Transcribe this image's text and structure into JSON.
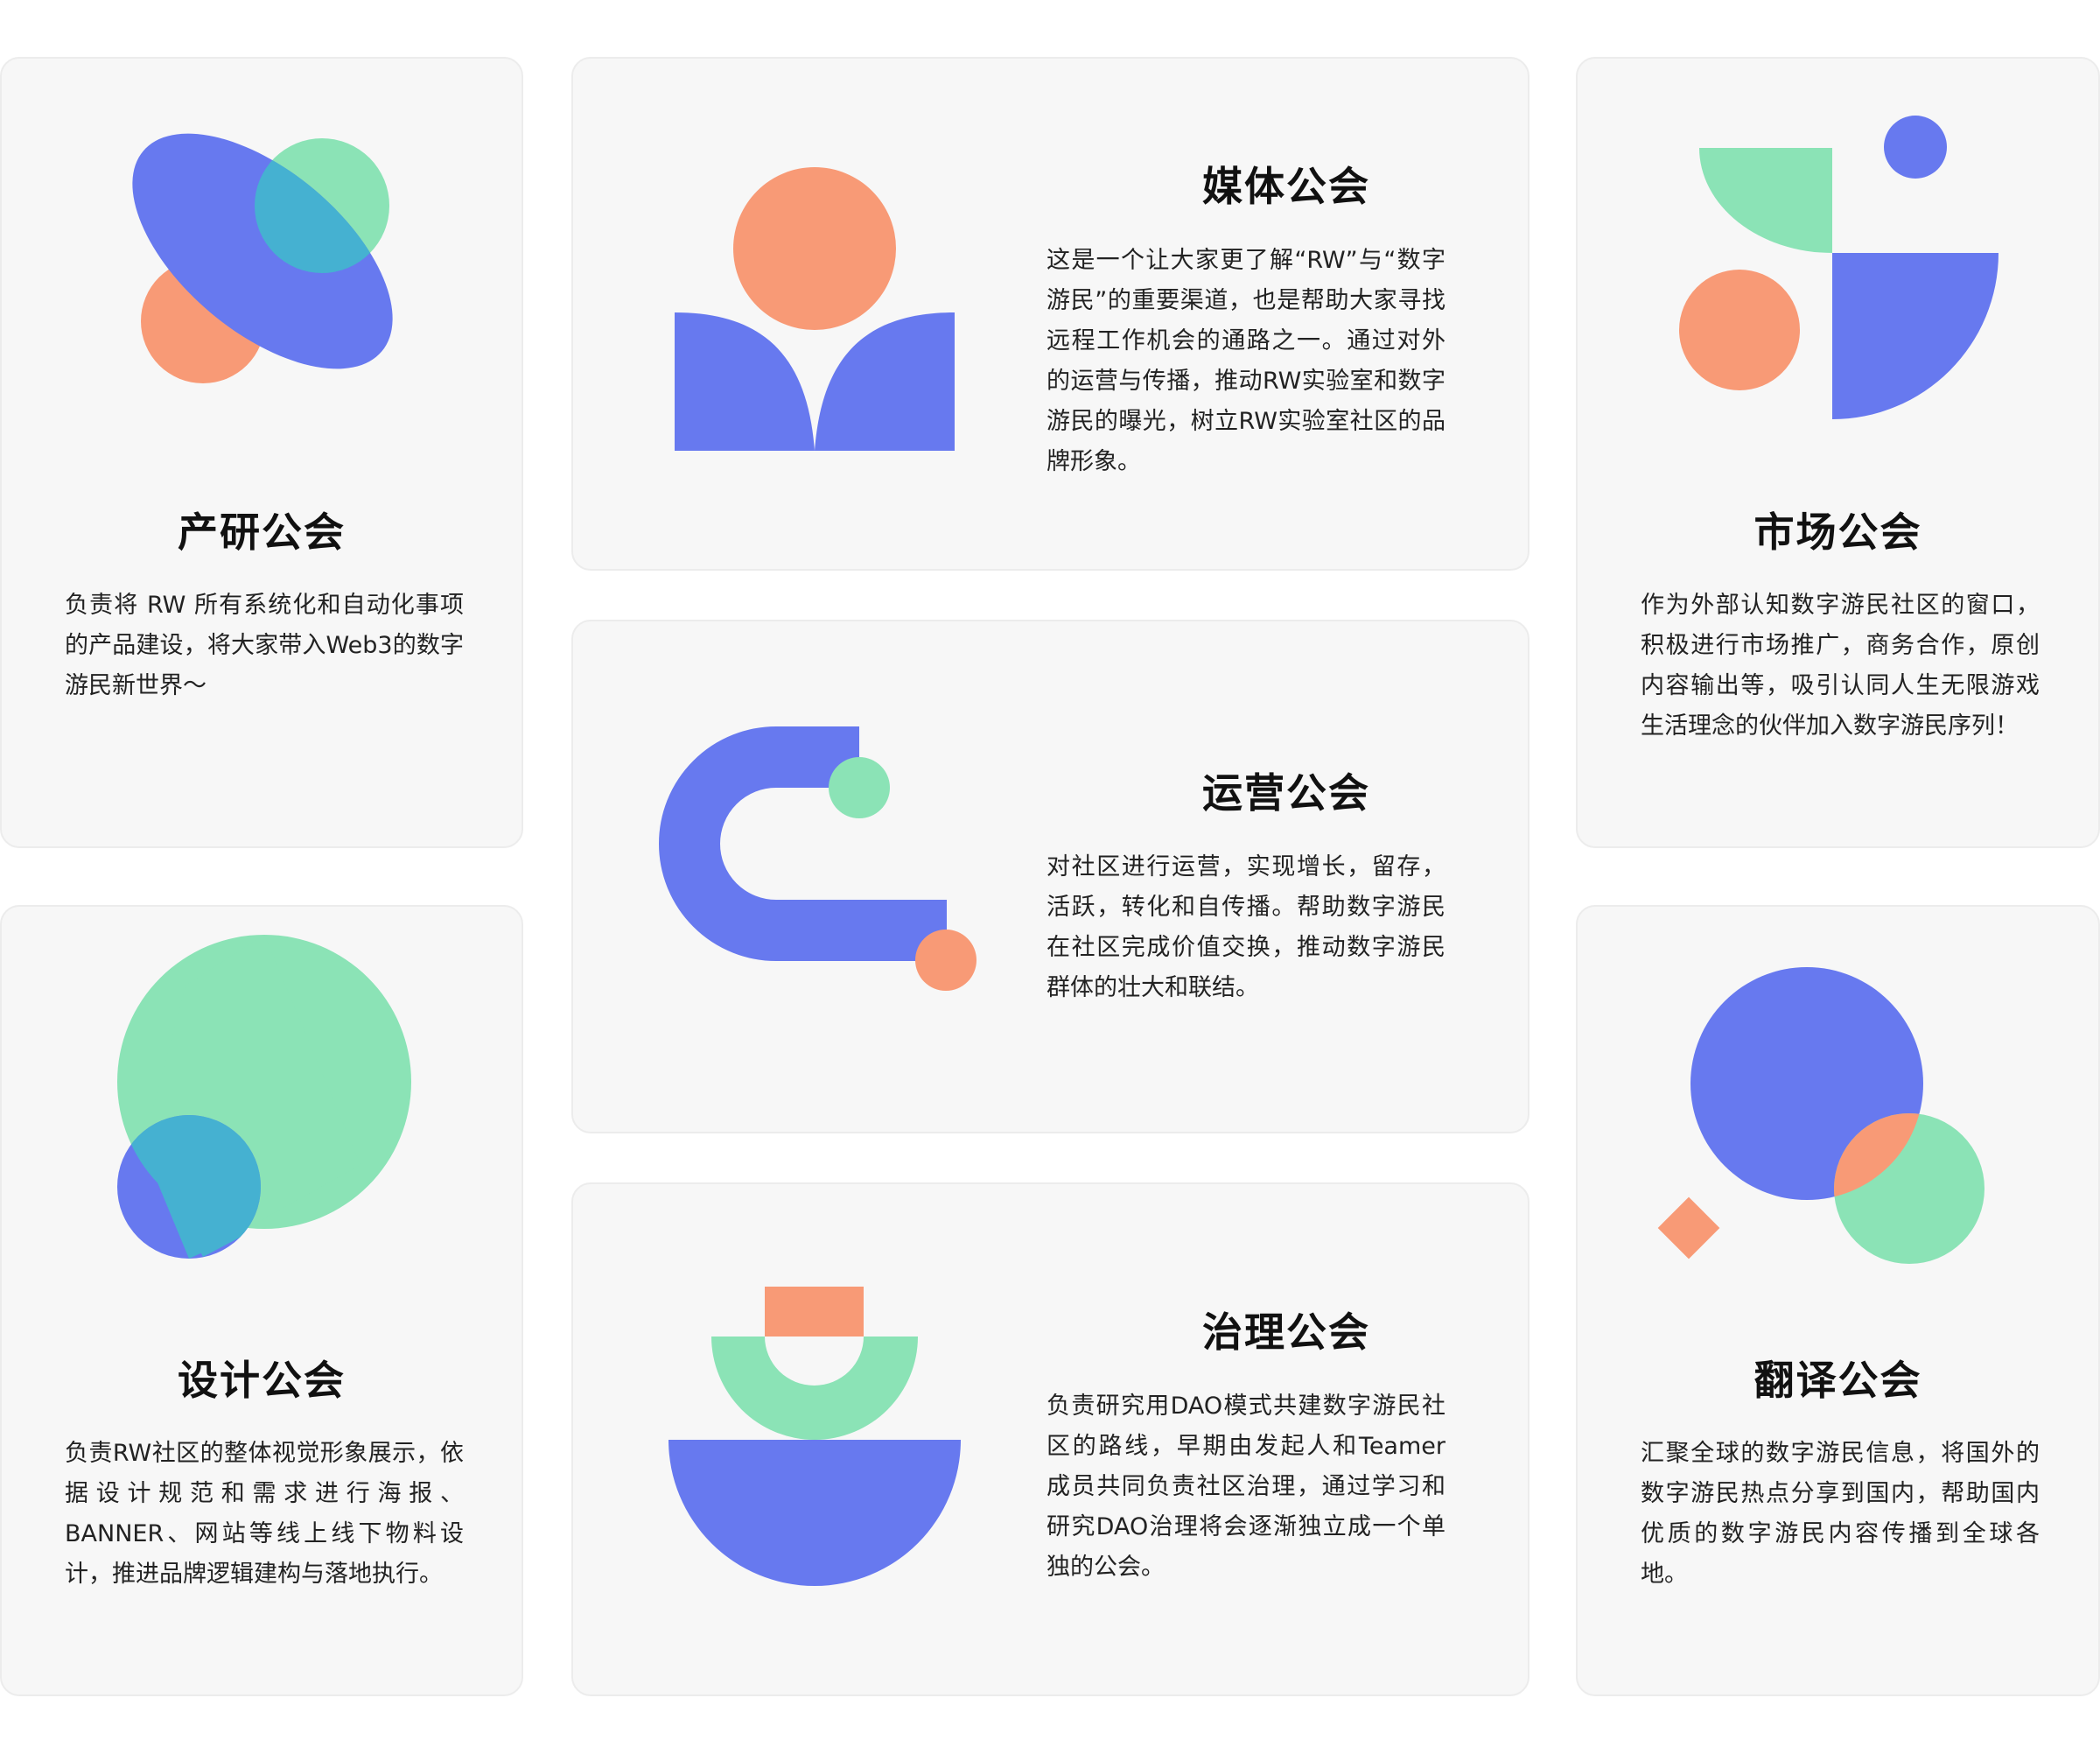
{
  "colors": {
    "blue": "#6779ef",
    "green": "#8be3b6",
    "orange": "#f89a76",
    "overlap": "#45b1d1",
    "card_bg": "#f7f7f7"
  },
  "cards": {
    "rd": {
      "title": "产研公会",
      "desc": "负责将 RW 所有系统化和自动化事项的产品建设，将大家带入Web3的数字游民新世界～",
      "icon": "ellipse-circles-icon"
    },
    "media": {
      "title": "媒体公会",
      "desc": "这是一个让大家更了解“RW”与“数字游民”的重要渠道，也是帮助大家寻找远程工作机会的通路之一。通过对外的运营与传播，推动RW实验室和数字游民的曝光，树立RW实验室社区的品牌形象。",
      "icon": "person-book-icon"
    },
    "market": {
      "title": "市场公会",
      "desc": "作为外部认知数字游民社区的窗口，积极进行市场推广，商务合作，原创内容输出等，吸引认同人生无限游戏生活理念的伙伴加入数字游民序列！",
      "icon": "quarter-shapes-icon"
    },
    "ops": {
      "title": "运营公会",
      "desc": "对社区进行运营，实现增长，留存，活跃，转化和自传播。帮助数字游民在社区完成价值交换，推动数字游民群体的壮大和联结。",
      "icon": "magnet-icon"
    },
    "design": {
      "title": "设计公会",
      "desc": "负责RW社区的整体视觉形象展示，依据设计规范和需求进行海报、BANNER、网站等线上线下物料设计，推进品牌逻辑建构与落地执行。",
      "icon": "cone-circle-icon"
    },
    "gov": {
      "title": "治理公会",
      "desc": "负责研究用DAO模式共建数字游民社区的路线，早期由发起人和Teamer 成员共同负责社区治理，通过学习和研究DAO治理将会逐渐独立成一个单独的公会。",
      "icon": "stacked-bowls-icon"
    },
    "translate": {
      "title": "翻译公会",
      "desc": "汇聚全球的数字游民信息，将国外的数字游民热点分享到国内，帮助国内优质的数字游民内容传播到全球各地。",
      "icon": "globe-circles-icon"
    }
  }
}
